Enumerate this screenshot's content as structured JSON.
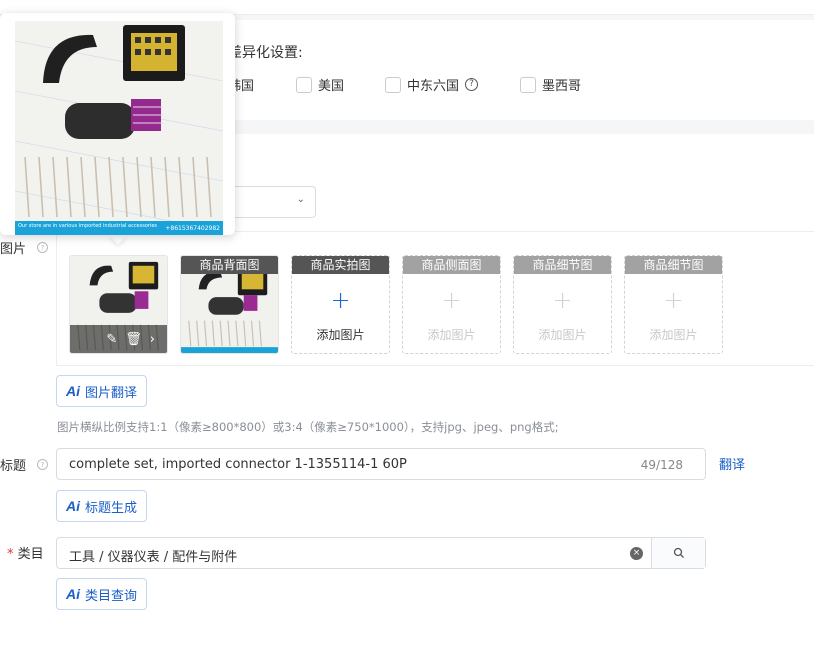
{
  "differentiation": {
    "title_partial": "差异化设置:",
    "left_cut_text": "行",
    "countries": [
      {
        "label": "韩国",
        "checked": false
      },
      {
        "label": "美国",
        "checked": false
      },
      {
        "label": "中东六国",
        "checked": false,
        "help": true
      },
      {
        "label": "墨西哥",
        "checked": false
      }
    ]
  },
  "images": {
    "label_partial": "图片",
    "slots": [
      {
        "header": "",
        "state": "filled-main"
      },
      {
        "header": "商品背面图",
        "state": "filled"
      },
      {
        "header": "商品实拍图",
        "state": "empty-active",
        "add_label": "添加图片"
      },
      {
        "header": "商品侧面图",
        "state": "empty",
        "add_label": "添加图片"
      },
      {
        "header": "商品细节图",
        "state": "empty",
        "add_label": "添加图片"
      },
      {
        "header": "商品细节图",
        "state": "empty",
        "add_label": "添加图片"
      }
    ],
    "translate_button": "图片翻译",
    "hint": "图片横纵比例支持1:1（像素≥800*800）或3:4（像素≥750*1000），支持jpg、jpeg、png格式;"
  },
  "title_field": {
    "label_partial": "标题",
    "value": "complete set,  imported connector 1-1355114-1 60P",
    "counter": "49/128",
    "translate_link": "翻译",
    "generate_button": "标题生成"
  },
  "category": {
    "label": "类目",
    "value": "工具 / 仪器仪表 / 配件与附件",
    "query_button": "类目查询"
  },
  "popover": {
    "footer_text": "Our store are in various imported industrial accessories",
    "footer_phone": "+8615367402982"
  },
  "ai_mark": "Ai"
}
